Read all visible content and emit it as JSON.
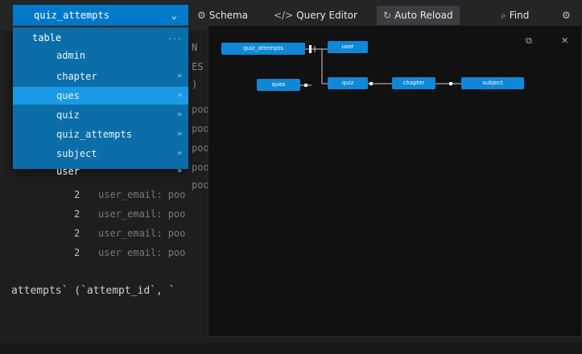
{
  "toolbar": {
    "table_select": "quiz_attempts",
    "schema": "Schema",
    "query_editor": "Query Editor",
    "auto_reload": "Auto Reload",
    "find": "Find"
  },
  "dropdown": {
    "header": "table",
    "header_more": "...",
    "items": [
      "admin",
      "chapter",
      "ques",
      "quiz",
      "quiz_attempts",
      "subject",
      "user"
    ],
    "selected": "ques"
  },
  "editor": {
    "fragments": {
      "a": "N",
      "b": "ES",
      "c": ")"
    },
    "rows": [
      {
        "num": "",
        "text": "poo"
      },
      {
        "num": "",
        "text": "poo"
      },
      {
        "num": "",
        "text": "poo"
      },
      {
        "num": "",
        "text": "poo"
      },
      {
        "num": "",
        "text": "poo"
      },
      {
        "num": "2",
        "text": "user_email: poo"
      },
      {
        "num": "2",
        "text": "user_email: poo"
      },
      {
        "num": "2",
        "text": "user_email: poo"
      },
      {
        "num": "2",
        "text": "user email: poo"
      }
    ],
    "sql_line": "attempts` (`attempt_id`, `"
  },
  "diagram": {
    "nodes": {
      "quiz_attempts": "quiz_attempts",
      "user": "user",
      "ques": "ques",
      "quiz": "quiz",
      "chapter": "chapter",
      "subject": "subject"
    }
  }
}
